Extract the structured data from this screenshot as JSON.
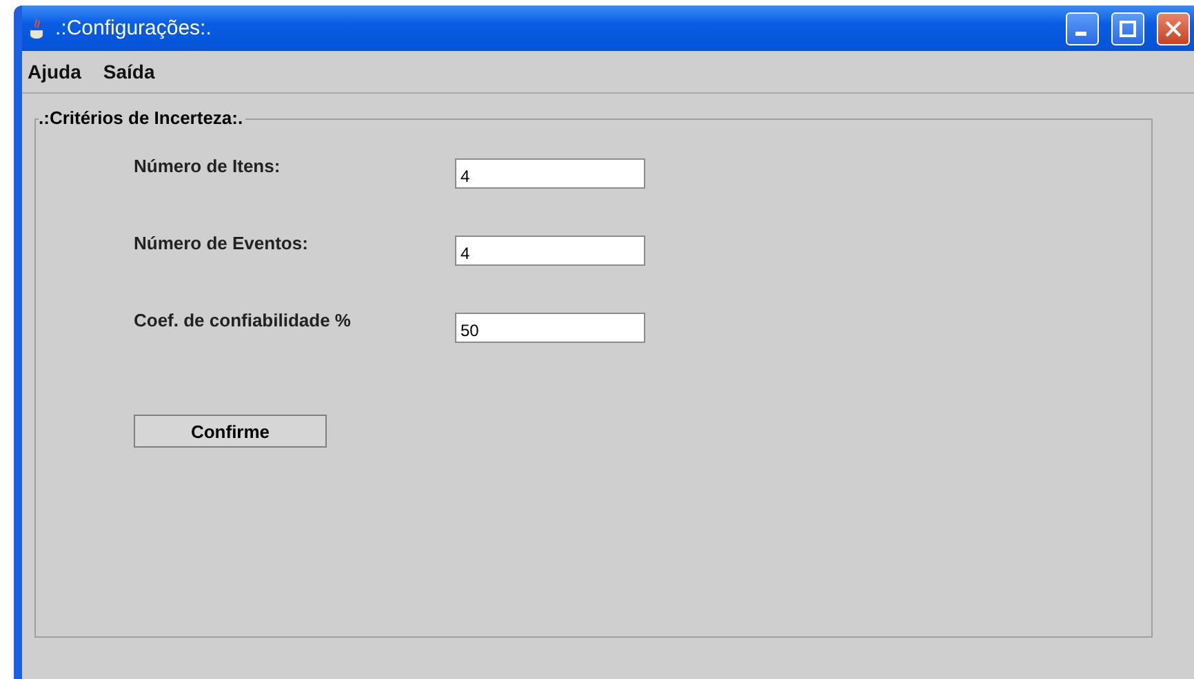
{
  "window": {
    "title": ".:Configurações:."
  },
  "menu": [
    "Ajuda",
    "Saída"
  ],
  "group": {
    "title": ".:Critérios de Incerteza:.",
    "fields": [
      {
        "label": "Número de Itens:",
        "value": "4"
      },
      {
        "label": "Número de Eventos:",
        "value": "4"
      },
      {
        "label": "Coef. de confiabilidade %",
        "value": "50"
      }
    ],
    "button": "Confirme"
  }
}
